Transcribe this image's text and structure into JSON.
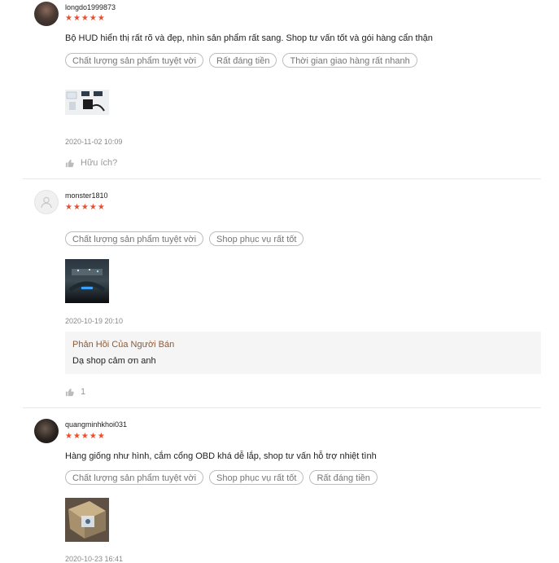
{
  "reviews": [
    {
      "username": "longdo1999873",
      "stars": "★★★★★",
      "comment": "Bộ HUD hiển thị rất rõ và đẹp, nhìn sản phẩm rất sang. Shop tư vấn tốt và gói hàng cẩn thận",
      "tags": [
        "Chất lượng sản phẩm tuyệt vời",
        "Rất đáng tiền",
        "Thời gian giao hàng rất nhanh"
      ],
      "date": "2020-11-02 10:09",
      "helpful_label": "Hữu ích?"
    },
    {
      "username": "monster1810",
      "stars": "★★★★★",
      "tags": [
        "Chất lượng sản phẩm tuyệt vời",
        "Shop phục vụ rất tốt"
      ],
      "date": "2020-10-19 20:10",
      "seller_reply_title": "Phản Hồi Của Người Bán",
      "seller_reply_text": "Dạ shop cảm ơn anh",
      "helpful_count": "1"
    },
    {
      "username": "quangminhkhoi031",
      "stars": "★★★★★",
      "comment": "Hàng giống như hình, cắm cổng OBD khá dễ lắp, shop tư vấn hỗ trợ nhiệt tình",
      "tags": [
        "Chất lượng sản phẩm tuyệt vời",
        "Shop phục vụ rất tốt",
        "Rất đáng tiền"
      ],
      "date": "2020-10-23 16:41"
    }
  ],
  "colors": {
    "star": "#ee4d2d",
    "seller_title": "#8a5a3a",
    "tag_border": "#bdbdbd"
  }
}
